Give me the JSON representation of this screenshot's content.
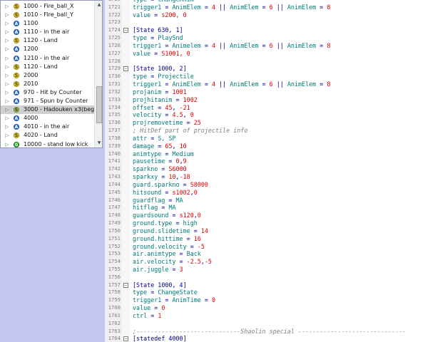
{
  "tree": {
    "items": [
      {
        "icon": "S",
        "icon_name": "state-icon",
        "label": "1000 - Fire_ball_X",
        "selected": false
      },
      {
        "icon": "S",
        "icon_name": "state-icon",
        "label": "1010 - Fire_ball_Y",
        "selected": false
      },
      {
        "icon": "A",
        "icon_name": "anim-icon",
        "label": "1100",
        "selected": false
      },
      {
        "icon": "A",
        "icon_name": "anim-icon",
        "label": "1110 - in the air",
        "selected": false
      },
      {
        "icon": "S",
        "icon_name": "state-icon",
        "label": "1120 - Land",
        "selected": false
      },
      {
        "icon": "A",
        "icon_name": "anim-icon",
        "label": "1200",
        "selected": false
      },
      {
        "icon": "A",
        "icon_name": "anim-icon",
        "label": "1210 - in the air",
        "selected": false
      },
      {
        "icon": "S",
        "icon_name": "state-icon",
        "label": "1120 - Land",
        "selected": false
      },
      {
        "icon": "S",
        "icon_name": "state-icon",
        "label": "2000",
        "selected": false
      },
      {
        "icon": "S",
        "icon_name": "state-icon",
        "label": "2010",
        "selected": false
      },
      {
        "icon": "A",
        "icon_name": "anim-icon",
        "label": "970 - Hit by Counter",
        "selected": false
      },
      {
        "icon": "A",
        "icon_name": "anim-icon",
        "label": "971 - Spun by Counter",
        "selected": false
      },
      {
        "icon": "Sg",
        "icon_name": "special-state-icon",
        "label": "3000 - Hadouken x3(begi...",
        "selected": true
      },
      {
        "icon": "A",
        "icon_name": "anim-icon",
        "label": "4000",
        "selected": false
      },
      {
        "icon": "A",
        "icon_name": "anim-icon",
        "label": "4010 - in the air",
        "selected": false
      },
      {
        "icon": "S",
        "icon_name": "state-icon",
        "label": "4020 - Land",
        "selected": false
      },
      {
        "icon": "G",
        "icon_name": "ground-state-icon",
        "label": "10000 - stand low kick",
        "selected": false
      }
    ]
  },
  "editor": {
    "lines": [
      {
        "n": "1720",
        "fold": false,
        "segs": [
          [
            "kw",
            "type"
          ],
          [
            "op",
            " = "
          ],
          [
            "kw",
            "ChangeAnim"
          ]
        ]
      },
      {
        "n": "1721",
        "fold": false,
        "segs": [
          [
            "kw",
            "trigger1"
          ],
          [
            "op",
            " = "
          ],
          [
            "kw",
            "AnimElem"
          ],
          [
            "op",
            " = "
          ],
          [
            "num",
            "4"
          ],
          [
            "op",
            " || "
          ],
          [
            "kw",
            "AnimElem"
          ],
          [
            "op",
            " = "
          ],
          [
            "num",
            "6"
          ],
          [
            "op",
            " || "
          ],
          [
            "kw",
            "AnimElem"
          ],
          [
            "op",
            " = "
          ],
          [
            "num",
            "8"
          ]
        ]
      },
      {
        "n": "1722",
        "fold": false,
        "segs": [
          [
            "kw",
            "value"
          ],
          [
            "op",
            " = "
          ],
          [
            "num",
            "s200, 0"
          ]
        ]
      },
      {
        "n": "1723",
        "fold": false,
        "segs": []
      },
      {
        "n": "1724",
        "fold": true,
        "segs": [
          [
            "hdr",
            "[State 630, 1]"
          ]
        ]
      },
      {
        "n": "1725",
        "fold": false,
        "segs": [
          [
            "kw",
            "type"
          ],
          [
            "op",
            " = "
          ],
          [
            "kw",
            "PlaySnd"
          ]
        ]
      },
      {
        "n": "1726",
        "fold": false,
        "segs": [
          [
            "kw",
            "trigger1"
          ],
          [
            "op",
            " = "
          ],
          [
            "kw",
            "Animelem"
          ],
          [
            "op",
            " = "
          ],
          [
            "num",
            "4"
          ],
          [
            "op",
            " || "
          ],
          [
            "kw",
            "AnimElem"
          ],
          [
            "op",
            " = "
          ],
          [
            "num",
            "6"
          ],
          [
            "op",
            " || "
          ],
          [
            "kw",
            "AnimElem"
          ],
          [
            "op",
            " = "
          ],
          [
            "num",
            "8"
          ]
        ]
      },
      {
        "n": "1727",
        "fold": false,
        "segs": [
          [
            "kw",
            "value"
          ],
          [
            "op",
            " = "
          ],
          [
            "num",
            "S1001, 0"
          ]
        ]
      },
      {
        "n": "1728",
        "fold": false,
        "segs": []
      },
      {
        "n": "1729",
        "fold": true,
        "segs": [
          [
            "hdr",
            "[State 1000, 2]"
          ]
        ]
      },
      {
        "n": "1730",
        "fold": false,
        "segs": [
          [
            "kw",
            "type"
          ],
          [
            "op",
            " = "
          ],
          [
            "kw",
            "Projectile"
          ]
        ]
      },
      {
        "n": "1731",
        "fold": false,
        "segs": [
          [
            "kw",
            "trigger1"
          ],
          [
            "op",
            " = "
          ],
          [
            "kw",
            "AnimElem"
          ],
          [
            "op",
            " = "
          ],
          [
            "num",
            "4"
          ],
          [
            "op",
            " || "
          ],
          [
            "kw",
            "AnimElem"
          ],
          [
            "op",
            " = "
          ],
          [
            "num",
            "6"
          ],
          [
            "op",
            " || "
          ],
          [
            "kw",
            "AnimElem"
          ],
          [
            "op",
            " = "
          ],
          [
            "num",
            "8"
          ]
        ]
      },
      {
        "n": "1732",
        "fold": false,
        "segs": [
          [
            "kw",
            "projanim"
          ],
          [
            "op",
            " = "
          ],
          [
            "num",
            "1001"
          ]
        ]
      },
      {
        "n": "1733",
        "fold": false,
        "segs": [
          [
            "kw",
            "projhitanim"
          ],
          [
            "op",
            " = "
          ],
          [
            "num",
            "1002"
          ]
        ]
      },
      {
        "n": "1734",
        "fold": false,
        "segs": [
          [
            "kw",
            "offset"
          ],
          [
            "op",
            " = "
          ],
          [
            "num",
            "45"
          ],
          [
            "op",
            ", "
          ],
          [
            "num",
            "-21"
          ]
        ]
      },
      {
        "n": "1735",
        "fold": false,
        "segs": [
          [
            "kw",
            "velocity"
          ],
          [
            "op",
            " = "
          ],
          [
            "num",
            "4.5"
          ],
          [
            "op",
            ", "
          ],
          [
            "num",
            "0"
          ]
        ]
      },
      {
        "n": "1736",
        "fold": false,
        "segs": [
          [
            "kw",
            "projremovetime"
          ],
          [
            "op",
            " = "
          ],
          [
            "num",
            "25"
          ]
        ]
      },
      {
        "n": "1737",
        "fold": false,
        "segs": [
          [
            "cmt",
            "; HitDef part of projectile info"
          ]
        ]
      },
      {
        "n": "1738",
        "fold": false,
        "segs": [
          [
            "kw",
            "attr"
          ],
          [
            "op",
            " = "
          ],
          [
            "kw",
            "S, SP"
          ]
        ]
      },
      {
        "n": "1739",
        "fold": false,
        "segs": [
          [
            "kw",
            "damage"
          ],
          [
            "op",
            " = "
          ],
          [
            "num",
            "65"
          ],
          [
            "op",
            ", "
          ],
          [
            "num",
            "10"
          ]
        ]
      },
      {
        "n": "1740",
        "fold": false,
        "segs": [
          [
            "kw",
            "animtype"
          ],
          [
            "op",
            " = "
          ],
          [
            "kw",
            "Medium"
          ]
        ]
      },
      {
        "n": "1741",
        "fold": false,
        "segs": [
          [
            "kw",
            "pausetime"
          ],
          [
            "op",
            " = "
          ],
          [
            "num",
            "0"
          ],
          [
            "op",
            ","
          ],
          [
            "num",
            "9"
          ]
        ]
      },
      {
        "n": "1742",
        "fold": false,
        "segs": [
          [
            "kw",
            "sparkno"
          ],
          [
            "op",
            " = "
          ],
          [
            "num",
            "S6000"
          ]
        ]
      },
      {
        "n": "1743",
        "fold": false,
        "segs": [
          [
            "kw",
            "sparkxy"
          ],
          [
            "op",
            " = "
          ],
          [
            "num",
            "10"
          ],
          [
            "op",
            ","
          ],
          [
            "num",
            "-18"
          ]
        ]
      },
      {
        "n": "1744",
        "fold": false,
        "segs": [
          [
            "kw",
            "guard.sparkno"
          ],
          [
            "op",
            " = "
          ],
          [
            "num",
            "S8000"
          ]
        ]
      },
      {
        "n": "1745",
        "fold": false,
        "segs": [
          [
            "kw",
            "hitsound"
          ],
          [
            "op",
            " = "
          ],
          [
            "num",
            "s1002"
          ],
          [
            "op",
            ","
          ],
          [
            "num",
            "0"
          ]
        ]
      },
      {
        "n": "1746",
        "fold": false,
        "segs": [
          [
            "kw",
            "guardflag"
          ],
          [
            "op",
            " = "
          ],
          [
            "kw",
            "MA"
          ]
        ]
      },
      {
        "n": "1747",
        "fold": false,
        "segs": [
          [
            "kw",
            "hitflag"
          ],
          [
            "op",
            " = "
          ],
          [
            "kw",
            "MA"
          ]
        ]
      },
      {
        "n": "1748",
        "fold": false,
        "segs": [
          [
            "kw",
            "guardsound"
          ],
          [
            "op",
            " = "
          ],
          [
            "num",
            "s120"
          ],
          [
            "op",
            ","
          ],
          [
            "num",
            "0"
          ]
        ]
      },
      {
        "n": "1749",
        "fold": false,
        "segs": [
          [
            "kw",
            "ground.type"
          ],
          [
            "op",
            " = "
          ],
          [
            "kw",
            "high"
          ]
        ]
      },
      {
        "n": "1750",
        "fold": false,
        "segs": [
          [
            "kw",
            "ground.slidetime"
          ],
          [
            "op",
            " = "
          ],
          [
            "num",
            "14"
          ]
        ]
      },
      {
        "n": "1751",
        "fold": false,
        "segs": [
          [
            "kw",
            "ground.hittime"
          ],
          [
            "op",
            " = "
          ],
          [
            "num",
            "16"
          ]
        ]
      },
      {
        "n": "1752",
        "fold": false,
        "segs": [
          [
            "kw",
            "ground.velocity"
          ],
          [
            "op",
            " = "
          ],
          [
            "num",
            "-5"
          ]
        ]
      },
      {
        "n": "1753",
        "fold": false,
        "segs": [
          [
            "kw",
            "air.animtype"
          ],
          [
            "op",
            " = "
          ],
          [
            "kw",
            "Back"
          ]
        ]
      },
      {
        "n": "1754",
        "fold": false,
        "segs": [
          [
            "kw",
            "air.velocity"
          ],
          [
            "op",
            " = "
          ],
          [
            "num",
            "-2.5"
          ],
          [
            "op",
            ","
          ],
          [
            "num",
            "-5"
          ]
        ]
      },
      {
        "n": "1755",
        "fold": false,
        "segs": [
          [
            "kw",
            "air.juggle"
          ],
          [
            "op",
            " = "
          ],
          [
            "num",
            "3"
          ]
        ]
      },
      {
        "n": "1756",
        "fold": false,
        "segs": []
      },
      {
        "n": "1757",
        "fold": true,
        "segs": [
          [
            "hdr",
            "[State 1000, 4]"
          ]
        ]
      },
      {
        "n": "1758",
        "fold": false,
        "segs": [
          [
            "kw",
            "type"
          ],
          [
            "op",
            " = "
          ],
          [
            "kw",
            "ChangeState"
          ]
        ]
      },
      {
        "n": "1759",
        "fold": false,
        "segs": [
          [
            "kw",
            "trigger1"
          ],
          [
            "op",
            " = "
          ],
          [
            "kw",
            "AnimTime"
          ],
          [
            "op",
            " = "
          ],
          [
            "num",
            "0"
          ]
        ]
      },
      {
        "n": "1760",
        "fold": false,
        "segs": [
          [
            "kw",
            "value"
          ],
          [
            "op",
            " = "
          ],
          [
            "num",
            "0"
          ]
        ]
      },
      {
        "n": "1761",
        "fold": false,
        "segs": [
          [
            "kw",
            "ctrl"
          ],
          [
            "op",
            " = "
          ],
          [
            "num",
            "1"
          ]
        ]
      },
      {
        "n": "1762",
        "fold": false,
        "segs": []
      },
      {
        "n": "1763",
        "fold": false,
        "segs": [
          [
            "cmt",
            ";-----------------------------Shaolin special ------------------------------"
          ]
        ]
      },
      {
        "n": "1764",
        "fold": true,
        "segs": [
          [
            "hdr",
            "[statedef 4000]"
          ]
        ]
      }
    ]
  },
  "colors": {
    "keyword": "#007a7a",
    "header": "#00008b",
    "number": "#e00000",
    "comment": "#808080",
    "left_background": "#c3c9f3"
  }
}
